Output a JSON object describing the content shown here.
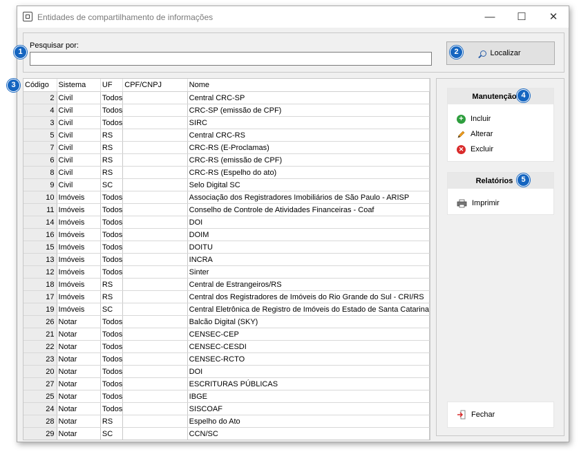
{
  "window": {
    "title": "Entidades de compartilhamento de informações",
    "minimize_glyph": "—",
    "maximize_glyph": "☐",
    "close_glyph": "✕"
  },
  "search": {
    "label": "Pesquisar por:",
    "value": "",
    "placeholder": "",
    "button_label": "Localizar"
  },
  "callouts": [
    "1",
    "2",
    "3",
    "4",
    "5"
  ],
  "grid": {
    "columns": [
      "Código",
      "Sistema",
      "UF",
      "CPF/CNPJ",
      "Nome"
    ],
    "rows": [
      [
        "2",
        "Civil",
        "Todos",
        "",
        "Central CRC-SP"
      ],
      [
        "4",
        "Civil",
        "Todos",
        "",
        "CRC-SP (emissão de CPF)"
      ],
      [
        "3",
        "Civil",
        "Todos",
        "",
        "SIRC"
      ],
      [
        "5",
        "Civil",
        "RS",
        "",
        "Central CRC-RS"
      ],
      [
        "7",
        "Civil",
        "RS",
        "",
        "CRC-RS (E-Proclamas)"
      ],
      [
        "6",
        "Civil",
        "RS",
        "",
        "CRC-RS (emissão de CPF)"
      ],
      [
        "8",
        "Civil",
        "RS",
        "",
        "CRC-RS (Espelho do ato)"
      ],
      [
        "9",
        "Civil",
        "SC",
        "",
        "Selo Digital SC"
      ],
      [
        "10",
        "Imóveis",
        "Todos",
        "",
        "Associação dos Registradores Imobiliários de São Paulo - ARISP"
      ],
      [
        "11",
        "Imóveis",
        "Todos",
        "",
        "Conselho de Controle de Atividades Financeiras - Coaf"
      ],
      [
        "14",
        "Imóveis",
        "Todos",
        "",
        "DOI"
      ],
      [
        "16",
        "Imóveis",
        "Todos",
        "",
        "DOIM"
      ],
      [
        "15",
        "Imóveis",
        "Todos",
        "",
        "DOITU"
      ],
      [
        "13",
        "Imóveis",
        "Todos",
        "",
        "INCRA"
      ],
      [
        "12",
        "Imóveis",
        "Todos",
        "",
        "Sinter"
      ],
      [
        "18",
        "Imóveis",
        "RS",
        "",
        "Central de Estrangeiros/RS"
      ],
      [
        "17",
        "Imóveis",
        "RS",
        "",
        "Central dos Registradores de Imóveis do Rio Grande do Sul - CRI/RS"
      ],
      [
        "19",
        "Imóveis",
        "SC",
        "",
        "Central Eletrônica de Registro de Imóveis do Estado de Santa Catarina"
      ],
      [
        "26",
        "Notar",
        "Todos",
        "",
        "Balcão Digital (SKY)"
      ],
      [
        "21",
        "Notar",
        "Todos",
        "",
        "CENSEC-CEP"
      ],
      [
        "22",
        "Notar",
        "Todos",
        "",
        "CENSEC-CESDI"
      ],
      [
        "23",
        "Notar",
        "Todos",
        "",
        "CENSEC-RCTO"
      ],
      [
        "20",
        "Notar",
        "Todos",
        "",
        "DOI"
      ],
      [
        "27",
        "Notar",
        "Todos",
        "",
        "ESCRITURAS PÚBLICAS"
      ],
      [
        "25",
        "Notar",
        "Todos",
        "",
        "IBGE"
      ],
      [
        "24",
        "Notar",
        "Todos",
        "",
        "SISCOAF"
      ],
      [
        "28",
        "Notar",
        "RS",
        "",
        "Espelho do Ato"
      ],
      [
        "29",
        "Notar",
        "SC",
        "",
        "CCN/SC"
      ]
    ]
  },
  "maintenance": {
    "title": "Manutenção",
    "include_label": "Incluir",
    "edit_label": "Alterar",
    "delete_label": "Excluir"
  },
  "reports": {
    "title": "Relatórios",
    "print_label": "Imprimir"
  },
  "close_label": "Fechar",
  "colors": {
    "accent": "#1565c0",
    "include": "#2e9e3e",
    "delete": "#d92b2b",
    "edit": "#f0a020"
  },
  "icons": {
    "search": "magnifier-icon",
    "include": "plus-circle-icon",
    "edit": "pencil-icon",
    "delete": "x-circle-icon",
    "print": "printer-icon",
    "close": "exit-door-icon"
  }
}
